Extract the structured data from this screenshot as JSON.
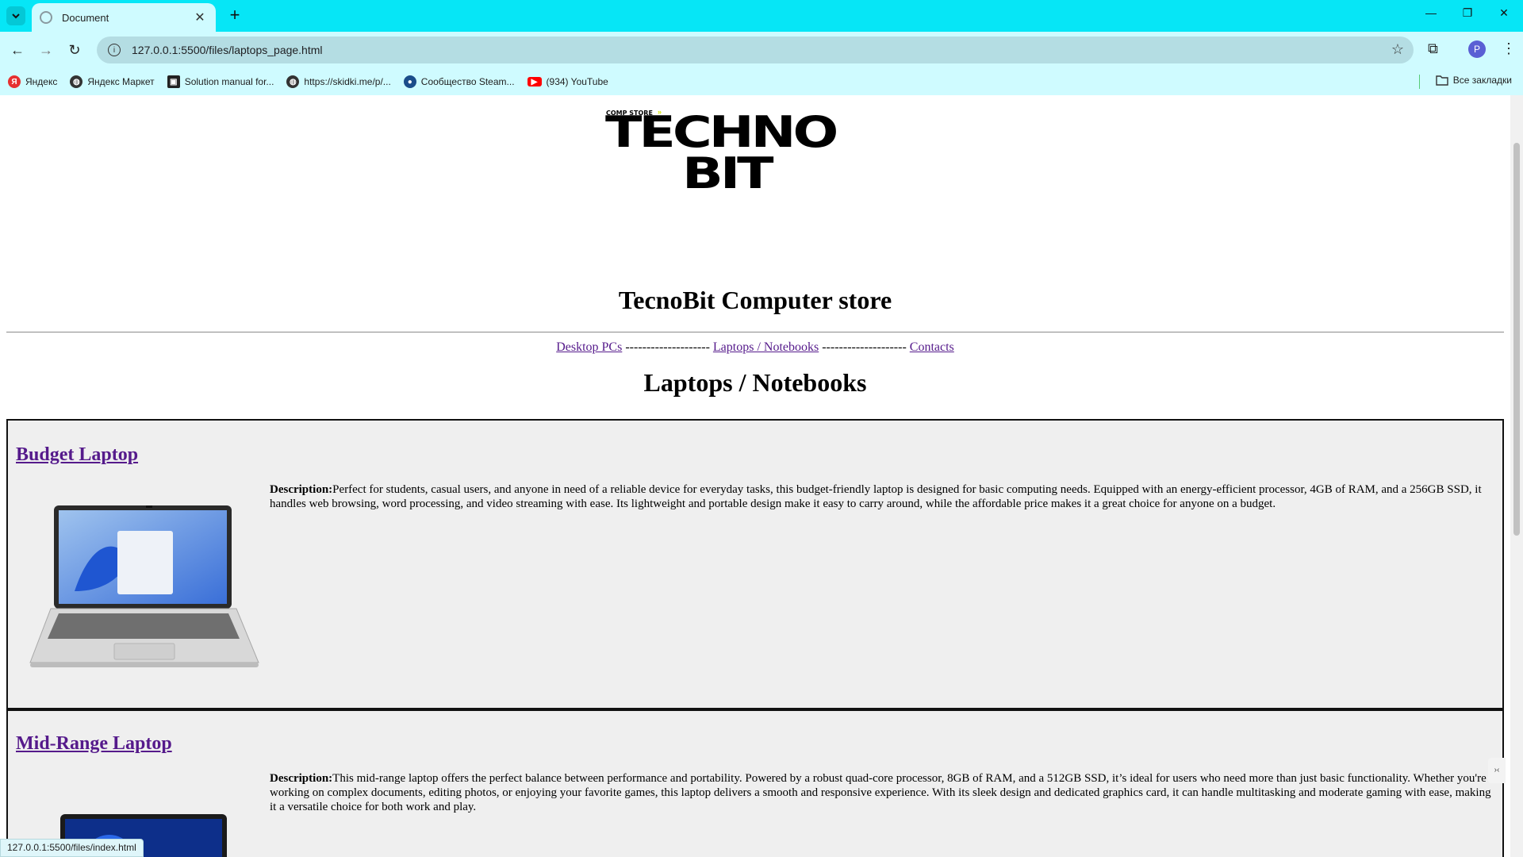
{
  "browser": {
    "tab_title": "Document",
    "new_tab_label": "+",
    "url": "127.0.0.1:5500/files/laptops_page.html",
    "status_url": "127.0.0.1:5500/files/index.html",
    "profile_initial": "P",
    "bookmarks": [
      {
        "label": "Яндекс",
        "icon": "yandex-icon",
        "color": "#e63030"
      },
      {
        "label": "Яндекс Маркет",
        "icon": "globe-icon",
        "color": "#333333"
      },
      {
        "label": "Solution manual for...",
        "icon": "site-icon",
        "color": "#222222"
      },
      {
        "label": "https://skidki.me/p/...",
        "icon": "globe-icon",
        "color": "#333333"
      },
      {
        "label": "Сообщество Steam...",
        "icon": "steam-icon",
        "color": "#1b4d8a"
      },
      {
        "label": "(934) YouTube",
        "icon": "youtube-icon",
        "color": "#ff0000"
      }
    ],
    "all_bookmarks_label": "Все закладки"
  },
  "page": {
    "logo": {
      "small": "COMP STORE",
      "line1": "TECHNO",
      "line2": "BIT"
    },
    "title": "TecnoBit Computer store",
    "nav": {
      "desktop": "Desktop PCs",
      "separator": "--------------------",
      "laptops": "Laptops / Notebooks",
      "contacts": "Contacts"
    },
    "section_title": "Laptops / Notebooks",
    "products": [
      {
        "name": "Budget Laptop",
        "desc_label": "Description:",
        "desc": "Perfect for students, casual users, and anyone in need of a reliable device for everyday tasks, this budget-friendly laptop is designed for basic computing needs. Equipped with an energy-efficient processor, 4GB of RAM, and a 256GB SSD, it handles web browsing, word processing, and video streaming with ease. Its lightweight and portable design make it easy to carry around, while the affordable price makes it a great choice for anyone on a budget."
      },
      {
        "name": "Mid-Range Laptop",
        "desc_label": "Description:",
        "desc": "This mid-range laptop offers the perfect balance between performance and portability. Powered by a robust quad-core processor, 8GB of RAM, and a 512GB SSD, it’s ideal for users who need more than just basic functionality. Whether you're working on complex documents, editing photos, or enjoying your favorite games, this laptop delivers a smooth and responsive experience. With its sleek design and dedicated graphics card, it can handle multitasking and moderate gaming with ease, making it a versatile choice for both work and play."
      }
    ]
  }
}
